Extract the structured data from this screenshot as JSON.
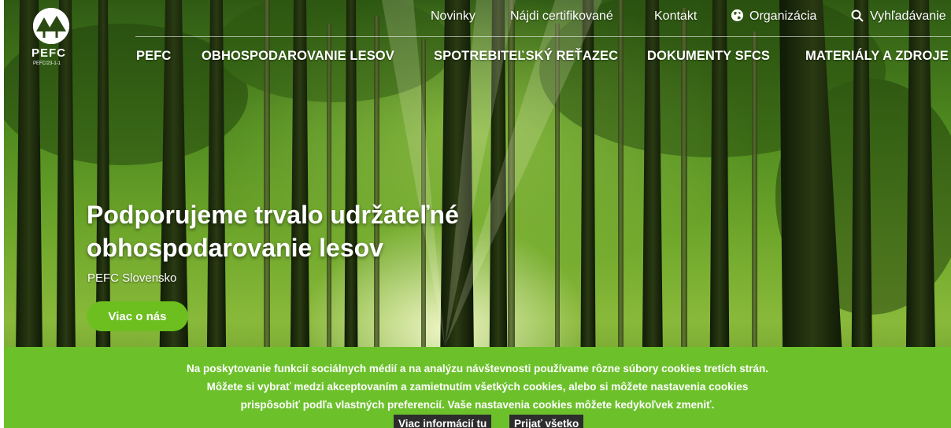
{
  "logo": {
    "word": "PEFC",
    "code": "PEFC/23-1-1"
  },
  "utility_nav": {
    "items": [
      "Novinky",
      "Nájdi certifikované",
      "Kontakt"
    ],
    "organization": "Organizácia",
    "search": "Vyhľadávanie"
  },
  "main_nav": {
    "items": [
      "PEFC",
      "OBHOSPODAROVANIE LESOV",
      "SPOTREBITEĽSKÝ REŤAZEC",
      "DOKUMENTY SFCS",
      "MATERIÁLY A ZDROJE"
    ]
  },
  "hero": {
    "title_line1": "Podporujeme trvalo udržateľné",
    "title_line2": "obhospodarovanie lesov",
    "subtitle": "PEFC Slovensko",
    "cta": "Viac o nás"
  },
  "cookie_banner": {
    "line1": "Na poskytovanie funkcií sociálnych médií a na analýzu návštevnosti používame rôzne súbory cookies tretích strán.",
    "line2": "Môžete si vybrať medzi akceptovaním a zamietnutím všetkých cookies, alebo si môžete nastavenia cookies",
    "line3": "prispôsobiť podľa vlastných preferencií. Vaše nastavenia cookies môžete kedykoľvek zmeniť.",
    "more_info": "Viac informácií tu",
    "accept_all": "Prijať všetko"
  },
  "colors": {
    "accent_green": "#6cc12b",
    "cta_green": "#6cbf1f",
    "dark_button": "#2d2d2d"
  },
  "icons": {
    "organization": "globe-icon",
    "search": "search-icon"
  }
}
